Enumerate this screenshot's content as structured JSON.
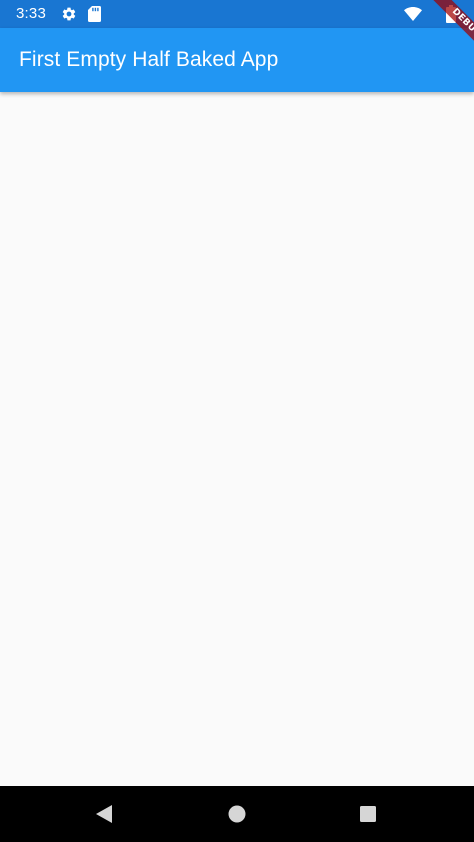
{
  "status_bar": {
    "time": "3:33",
    "icons": [
      "settings-icon",
      "sd-card-icon",
      "wifi-icon",
      "battery-icon"
    ],
    "background": "#1976d2"
  },
  "app_bar": {
    "title": "First Empty Half Baked App",
    "background": "#2196f3"
  },
  "debug_banner": {
    "label": "DEBUG"
  },
  "nav_bar": {
    "buttons": [
      "back-icon",
      "home-icon",
      "recents-icon"
    ],
    "background": "#000000"
  },
  "content": {
    "background": "#fafafa"
  }
}
